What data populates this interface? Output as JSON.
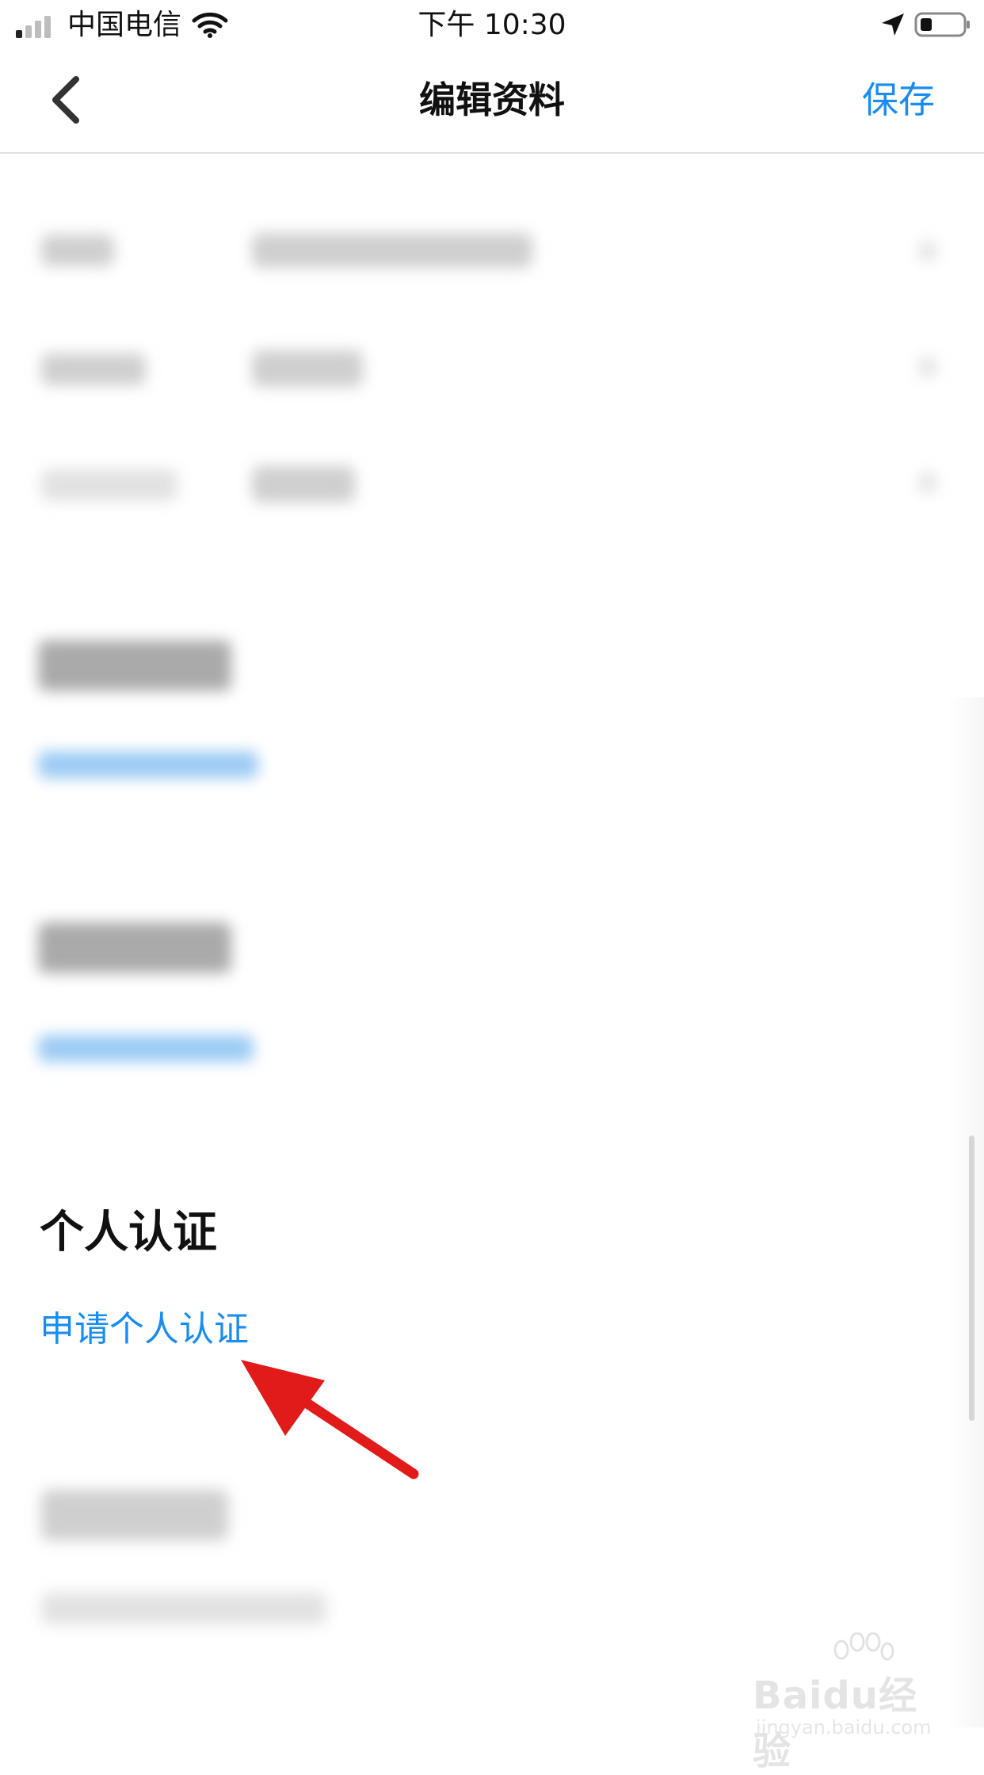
{
  "status_bar": {
    "carrier": "中国电信",
    "time": "下午 10:30"
  },
  "nav": {
    "title": "编辑资料",
    "save_label": "保存"
  },
  "verification": {
    "title": "个人认证",
    "apply_label": "申请个人认证"
  },
  "watermark": {
    "text": "Baidu经验",
    "url": "jingyan.baidu.com"
  },
  "colors": {
    "accent": "#1a8cf0",
    "annotation": "#e11a1a"
  },
  "icons": {
    "back": "chevron-left-icon",
    "location": "location-arrow-icon",
    "battery": "battery-icon",
    "wifi": "wifi-icon",
    "signal": "cellular-signal-icon"
  }
}
